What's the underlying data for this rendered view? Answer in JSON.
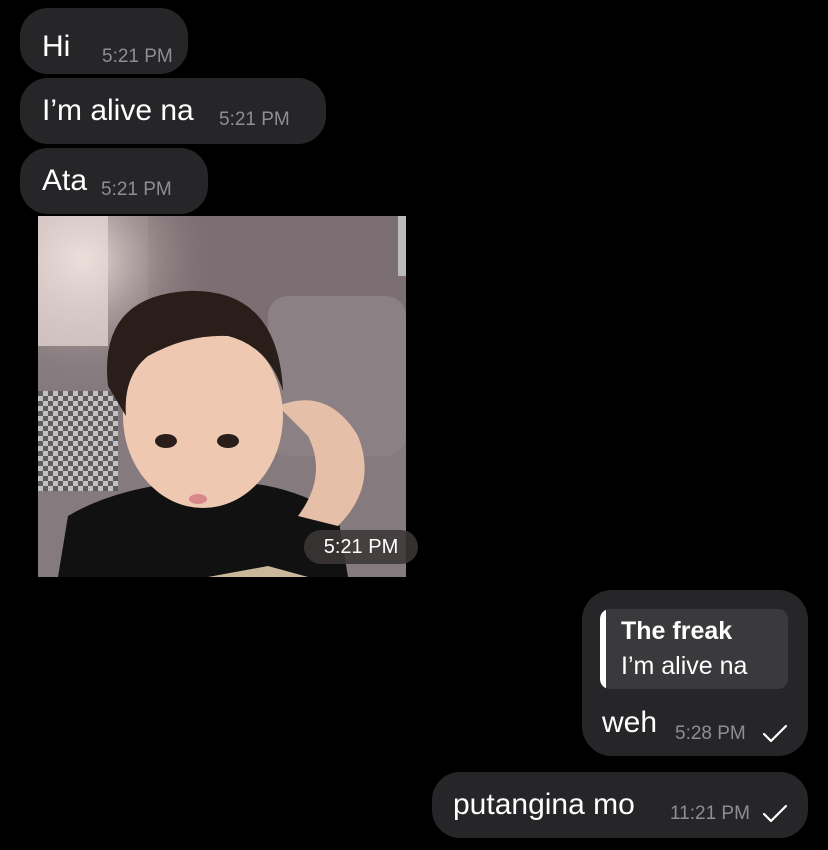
{
  "messages": [
    {
      "text": "Hi",
      "time": "5:21 PM",
      "direction": "incoming"
    },
    {
      "text": "I’m alive na",
      "time": "5:21 PM",
      "direction": "incoming"
    },
    {
      "text": "Ata",
      "time": "5:21 PM",
      "direction": "incoming"
    },
    {
      "type": "photo",
      "time": "5:21 PM",
      "direction": "incoming"
    },
    {
      "direction": "outgoing",
      "reply": {
        "author": "The freak",
        "text": "I’m alive na"
      },
      "text": "weh",
      "time": "5:28 PM",
      "status_icon": "check-icon"
    },
    {
      "text": "putangina mo",
      "time": "11:21 PM",
      "direction": "outgoing",
      "status_icon": "check-icon"
    }
  ],
  "colors": {
    "background": "#000000",
    "bubble": "#262628",
    "quote_background": "#3a3a3c",
    "timestamp": "#8e8e93",
    "text": "#ffffff"
  }
}
